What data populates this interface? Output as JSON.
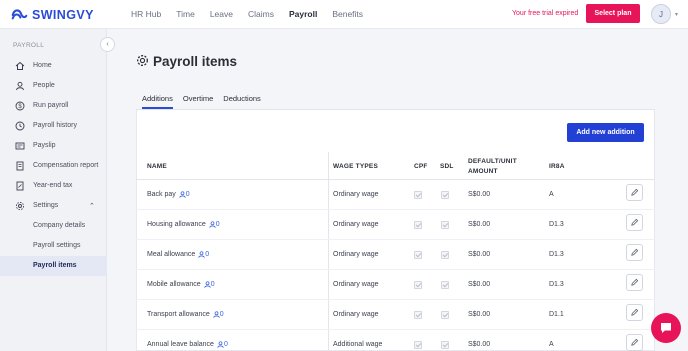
{
  "brand": {
    "name": "SWINGVY",
    "color": "#2a4bd6"
  },
  "topnav": [
    "HR Hub",
    "Time",
    "Leave",
    "Claims",
    "Payroll",
    "Benefits"
  ],
  "topnav_active": "Payroll",
  "trial_text": "Your free trial expired",
  "select_plan": "Select plan",
  "avatar_initial": "J",
  "sidebar": {
    "title": "PAYROLL",
    "items": [
      {
        "label": "Home",
        "icon": "home-icon"
      },
      {
        "label": "People",
        "icon": "user-icon"
      },
      {
        "label": "Run payroll",
        "icon": "dollar-icon"
      },
      {
        "label": "Payroll history",
        "icon": "history-icon"
      },
      {
        "label": "Payslip",
        "icon": "payslip-icon"
      },
      {
        "label": "Compensation report",
        "icon": "report-icon"
      },
      {
        "label": "Year-end tax",
        "icon": "tax-icon"
      },
      {
        "label": "Settings",
        "icon": "gear-icon",
        "expanded": true
      },
      {
        "label": "Company details",
        "sub": true
      },
      {
        "label": "Payroll settings",
        "sub": true
      },
      {
        "label": "Payroll items",
        "sub": true,
        "active": true
      }
    ]
  },
  "page": {
    "title": "Payroll items",
    "tabs": [
      "Additions",
      "Overtime",
      "Deductions"
    ],
    "active_tab": "Additions",
    "add_button": "Add new addition",
    "columns": {
      "name": "NAME",
      "wage_types": "WAGE TYPES",
      "cpf": "CPF",
      "sdl": "SDL",
      "default_1": "DEFAULT/UNIT",
      "default_2": "AMOUNT",
      "ir8a": "IR8A"
    },
    "rows": [
      {
        "name": "Back pay",
        "employees": "0",
        "wage_type": "Ordinary wage",
        "amount": "S$0.00",
        "ir8a": "A"
      },
      {
        "name": "Housing allowance",
        "employees": "0",
        "wage_type": "Ordinary wage",
        "amount": "S$0.00",
        "ir8a": "D1.3"
      },
      {
        "name": "Meal allowance",
        "employees": "0",
        "wage_type": "Ordinary wage",
        "amount": "S$0.00",
        "ir8a": "D1.3"
      },
      {
        "name": "Mobile allowance",
        "employees": "0",
        "wage_type": "Ordinary wage",
        "amount": "S$0.00",
        "ir8a": "D1.3"
      },
      {
        "name": "Transport allowance",
        "employees": "0",
        "wage_type": "Ordinary wage",
        "amount": "S$0.00",
        "ir8a": "D1.1"
      },
      {
        "name": "Annual leave balance",
        "employees": "0",
        "wage_type": "Additional wage",
        "amount": "S$0.00",
        "ir8a": "A"
      }
    ]
  },
  "colors": {
    "accent": "#2340d4",
    "brand_pink": "#e8145a"
  }
}
